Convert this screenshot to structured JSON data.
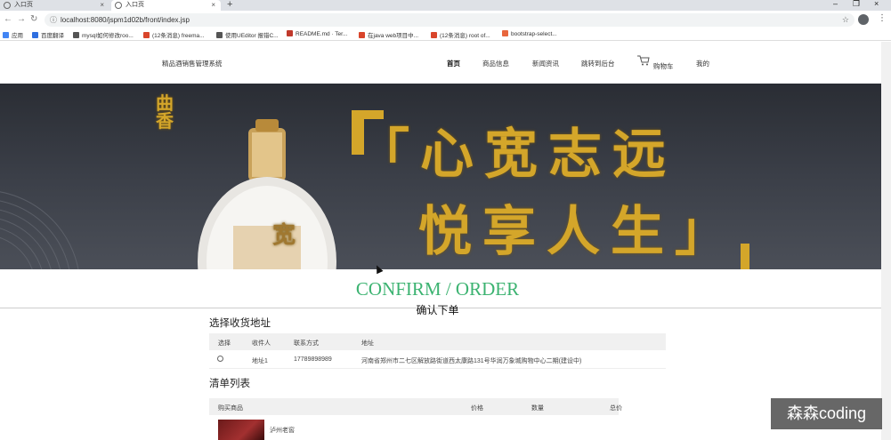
{
  "browser": {
    "tabs": [
      {
        "title": "入口页",
        "active": false
      },
      {
        "title": "入口页",
        "active": true
      }
    ],
    "new_tab": "+",
    "window_controls": [
      "–",
      "❐",
      "×"
    ],
    "url": "localhost:8080/jspm1d02b/front/index.jsp",
    "bookmarks": [
      {
        "label": "应用",
        "color": "#4285f4"
      },
      {
        "label": "百度翻译",
        "color": "#2f6fe0"
      },
      {
        "label": "mysql如何修改roo...",
        "color": "#555555"
      },
      {
        "label": "(12条消息) freema...",
        "color": "#d9452b"
      },
      {
        "label": "使用UEditor 报错C...",
        "color": "#555555"
      },
      {
        "label": "README.md · Ter...",
        "color": "#c0392b"
      },
      {
        "label": "在java web项目中...",
        "color": "#d9452b"
      },
      {
        "label": "(12条消息) root of...",
        "color": "#d9452b"
      },
      {
        "label": "bootstrap-select...",
        "color": "#e8663d"
      }
    ]
  },
  "site": {
    "title": "精品酒销售管理系统",
    "nav": [
      {
        "label": "首页",
        "active": true
      },
      {
        "label": "商品信息",
        "active": false
      },
      {
        "label": "新闻资讯",
        "active": false
      },
      {
        "label": "跳转到后台",
        "active": false
      },
      {
        "label": "购物车",
        "active": false,
        "icon": "cart-icon"
      },
      {
        "label": "我的",
        "active": false
      }
    ]
  },
  "banner": {
    "brand_mark": "曲香",
    "slogan_line1": "「心宽志远",
    "slogan_line2": "悦享人生」",
    "bottle_label": "宽"
  },
  "confirm": {
    "title": "CONFIRM / ORDER",
    "subtitle": "确认下单"
  },
  "address_section": {
    "heading": "选择收货地址",
    "columns": [
      "选择",
      "收件人",
      "联系方式",
      "地址"
    ],
    "rows": [
      {
        "recipient": "地址1",
        "phone": "17789898989",
        "address": "河南省郑州市二七区解放路街道西太康路131号华润万象城购物中心二期(建设中)"
      }
    ]
  },
  "items_section": {
    "heading": "清单列表",
    "columns": [
      "购买商品",
      "价格",
      "数量",
      "总价"
    ],
    "rows": [
      {
        "product": "泸州老窖"
      }
    ]
  },
  "watermark": "森森coding"
}
